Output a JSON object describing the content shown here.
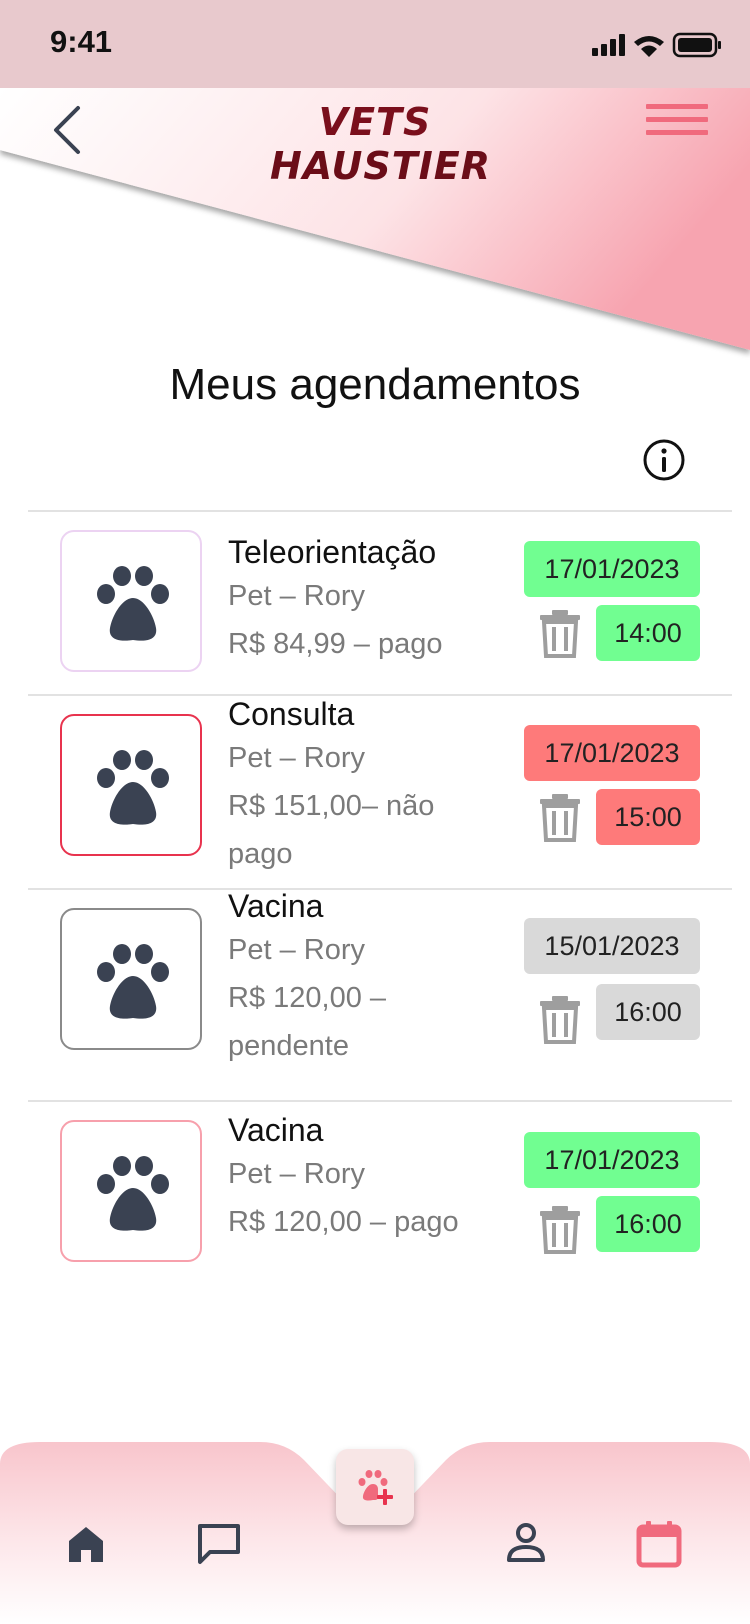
{
  "status_bar": {
    "time": "9:41"
  },
  "header": {
    "logo_line1": "VETS",
    "logo_line2": "HAUSTIER",
    "title": "Meus agendamentos"
  },
  "colors": {
    "accent": "#f06a7d",
    "paid": "#71fe91",
    "unpaid": "#fe7a7a",
    "pending": "#d9d9d9",
    "icon_dark": "#3a4252"
  },
  "appointments": [
    {
      "title": "Teleorientação",
      "pet": "Pet –  Rory",
      "price_line": "R$ 84,99 – pago",
      "price_line2": "",
      "date": "17/01/2023",
      "time": "14:00",
      "status": "pago",
      "icon": "paw-icon"
    },
    {
      "title": "Consulta",
      "pet": "Pet –  Rory",
      "price_line": "R$ 151,00– não",
      "price_line2": "pago",
      "date": "17/01/2023",
      "time": "15:00",
      "status": "não pago",
      "icon": "paw-icon"
    },
    {
      "title": "Vacina",
      "pet": "Pet – Rory",
      "price_line": "R$ 120,00 –",
      "price_line2": "pendente",
      "date": "15/01/2023",
      "time": "16:00",
      "status": "pendente",
      "icon": "paw-icon"
    },
    {
      "title": "Vacina",
      "pet": "Pet – Rory",
      "price_line": "R$ 120,00 –  pago",
      "price_line2": "",
      "date": "17/01/2023",
      "time": "16:00",
      "status": "pago",
      "icon": "paw-icon"
    }
  ],
  "bottom_nav": {
    "items": [
      "home-icon",
      "chat-icon",
      "add-pet-icon",
      "profile-icon",
      "calendar-icon"
    ],
    "active": "calendar-icon"
  }
}
